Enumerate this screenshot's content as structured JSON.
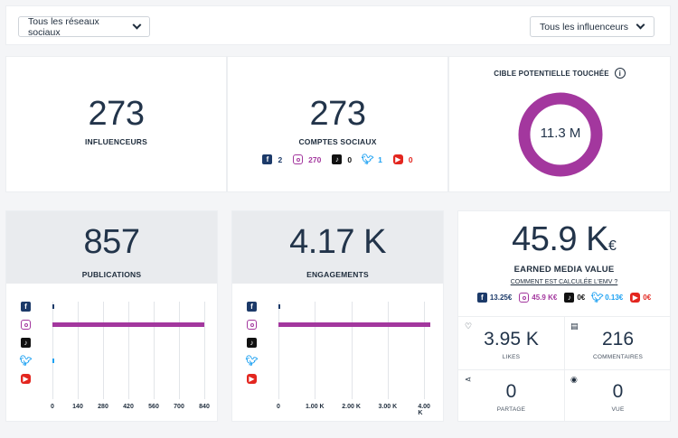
{
  "filters": {
    "networks_label": "Tous les réseaux sociaux",
    "influencers_label": "Tous les influenceurs"
  },
  "kpis": {
    "influencers": {
      "value": "273",
      "label": "INFLUENCEURS"
    },
    "accounts": {
      "value": "273",
      "label": "COMPTES SOCIAUX",
      "breakdown": {
        "facebook": "2",
        "instagram": "270",
        "tiktok": "0",
        "twitter": "1",
        "youtube": "0"
      }
    },
    "reach": {
      "title": "CIBLE POTENTIELLE TOUCHÉE",
      "value": "11.3 M"
    }
  },
  "publications": {
    "value": "857",
    "label": "PUBLICATIONS",
    "axis_ticks": [
      "0",
      "140",
      "280",
      "420",
      "560",
      "700",
      "840"
    ]
  },
  "engagements": {
    "value": "4.17 K",
    "label": "ENGAGEMENTS",
    "axis_ticks": [
      "0",
      "1.00 K",
      "2.00 K",
      "3.00 K",
      "4.00 K"
    ]
  },
  "emv": {
    "value": "45.9 K",
    "currency": "€",
    "label": "EARNED MEDIA VALUE",
    "link": "COMMENT EST CALCULÉE L'EMV ?",
    "breakdown": {
      "facebook": "13.25€",
      "instagram": "45.9 K€",
      "tiktok": "0€",
      "twitter": "0.13€",
      "youtube": "0€"
    }
  },
  "stats": {
    "likes": {
      "value": "3.95 K",
      "label": "LIKES"
    },
    "comments": {
      "value": "216",
      "label": "COMMENTAIRES"
    },
    "shares": {
      "value": "0",
      "label": "PARTAGE"
    },
    "views": {
      "value": "0",
      "label": "VUE"
    }
  },
  "chart_data": [
    {
      "type": "bar",
      "title": "PUBLICATIONS",
      "categories": [
        "facebook",
        "instagram",
        "tiktok",
        "twitter",
        "youtube"
      ],
      "values": [
        2,
        854,
        0,
        1,
        0
      ],
      "xlim": [
        0,
        840
      ]
    },
    {
      "type": "bar",
      "title": "ENGAGEMENTS",
      "categories": [
        "facebook",
        "instagram",
        "tiktok",
        "twitter",
        "youtube"
      ],
      "values": [
        10,
        4160,
        0,
        0,
        0
      ],
      "xlim": [
        0,
        4000
      ]
    }
  ],
  "colors": {
    "facebook": "#1c3a69",
    "instagram": "#a3379e",
    "tiktok": "#111111",
    "twitter": "#1da1f2",
    "youtube": "#e3261f"
  }
}
